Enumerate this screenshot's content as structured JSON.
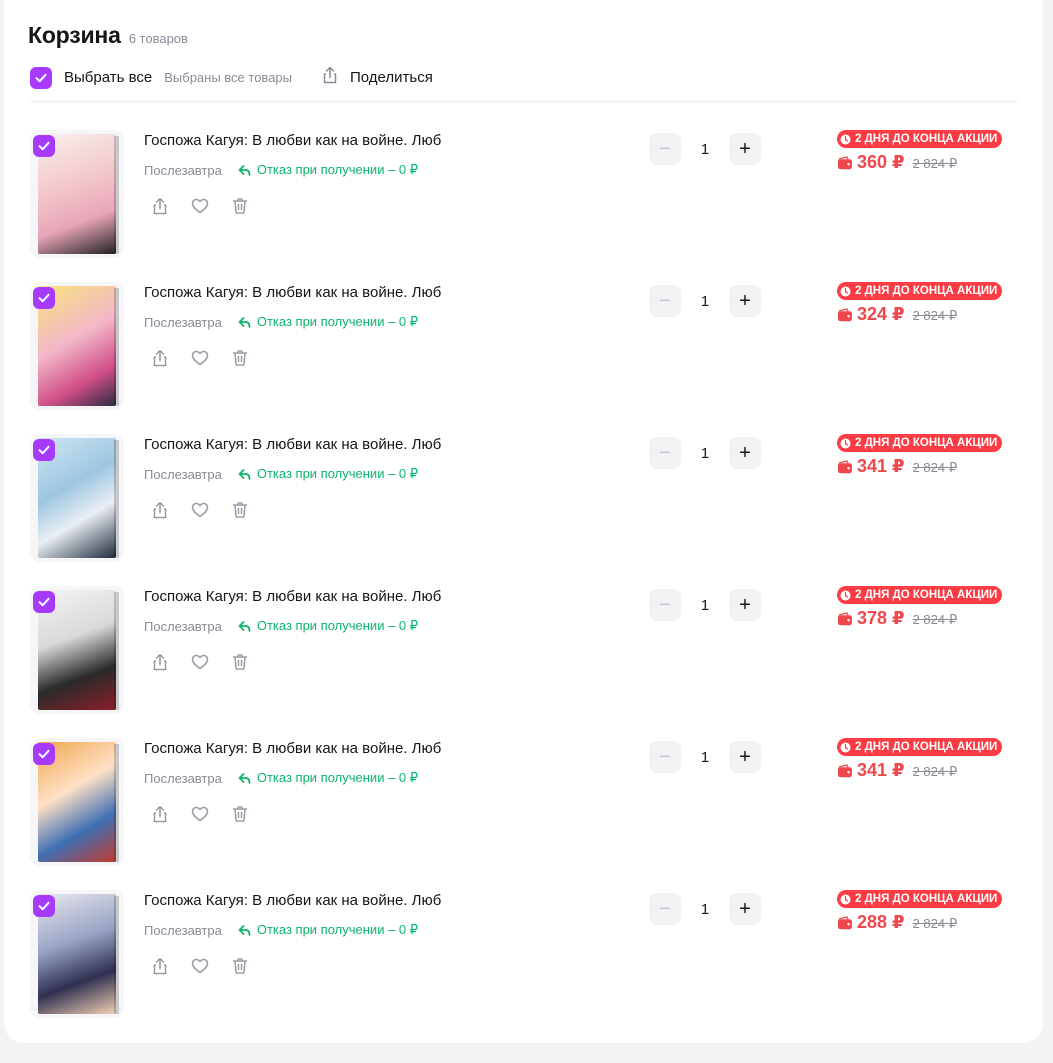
{
  "cart": {
    "title": "Корзина",
    "count": "6 товаров",
    "select_all": "Выбрать все",
    "selected_note": "Выбраны все товары",
    "share_label": "Поделиться"
  },
  "colors": {
    "accent": "#a73afd",
    "sale": "#f0474c",
    "promo_badge": "#ff3b43",
    "refuse_green": "#08b56b"
  },
  "icons": [
    "check-icon",
    "share-icon",
    "heart-icon",
    "trash-icon",
    "return-arrow-icon",
    "clock-icon",
    "wallet-icon",
    "minus-icon",
    "plus-icon"
  ],
  "items": [
    {
      "title": "Госпожа Кагуя: В любви как на войне. Люб",
      "delivery": "Послезавтра",
      "refuse": "Отказ при получении – 0 ₽",
      "qty": "1",
      "minus": "−",
      "plus": "+",
      "promo": "2 ДНЯ ДО КОНЦА АКЦИИ",
      "price": "360 ₽",
      "old_price": "2 824 ₽",
      "checked": true
    },
    {
      "title": "Госпожа Кагуя: В любви как на войне. Люб",
      "delivery": "Послезавтра",
      "refuse": "Отказ при получении – 0 ₽",
      "qty": "1",
      "minus": "−",
      "plus": "+",
      "promo": "2 ДНЯ ДО КОНЦА АКЦИИ",
      "price": "324 ₽",
      "old_price": "2 824 ₽",
      "checked": true
    },
    {
      "title": "Госпожа Кагуя: В любви как на войне. Люб",
      "delivery": "Послезавтра",
      "refuse": "Отказ при получении – 0 ₽",
      "qty": "1",
      "minus": "−",
      "plus": "+",
      "promo": "2 ДНЯ ДО КОНЦА АКЦИИ",
      "price": "341 ₽",
      "old_price": "2 824 ₽",
      "checked": true
    },
    {
      "title": "Госпожа Кагуя: В любви как на войне. Люб",
      "delivery": "Послезавтра",
      "refuse": "Отказ при получении – 0 ₽",
      "qty": "1",
      "minus": "−",
      "plus": "+",
      "promo": "2 ДНЯ ДО КОНЦА АКЦИИ",
      "price": "378 ₽",
      "old_price": "2 824 ₽",
      "checked": true
    },
    {
      "title": "Госпожа Кагуя: В любви как на войне. Люб",
      "delivery": "Послезавтра",
      "refuse": "Отказ при получении – 0 ₽",
      "qty": "1",
      "minus": "−",
      "plus": "+",
      "promo": "2 ДНЯ ДО КОНЦА АКЦИИ",
      "price": "341 ₽",
      "old_price": "2 824 ₽",
      "checked": true
    },
    {
      "title": "Госпожа Кагуя: В любви как на войне. Люб",
      "delivery": "Послезавтра",
      "refuse": "Отказ при получении – 0 ₽",
      "qty": "1",
      "minus": "−",
      "plus": "+",
      "promo": "2 ДНЯ ДО КОНЦА АКЦИИ",
      "price": "288 ₽",
      "old_price": "2 824 ₽",
      "checked": true
    }
  ]
}
